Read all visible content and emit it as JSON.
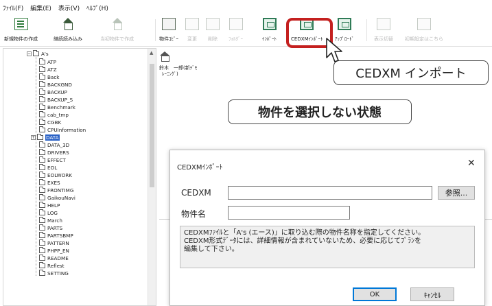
{
  "menu": [
    "ﾌｧｲﾙ(F)",
    "編集(E)",
    "表示(V)",
    "ﾍﾙﾌﾟ(H)"
  ],
  "toolbar": {
    "items": [
      {
        "label": "新規物件の作成",
        "icon": "new-doc-icon",
        "enabled": true
      },
      {
        "label": "継続読み込み",
        "icon": "house-open-icon",
        "enabled": true
      },
      {
        "label": "当初物件で作成",
        "icon": "house-copy-icon",
        "enabled": false
      },
      {
        "label": "物件ｺﾋﾟｰ",
        "icon": "copy-icon",
        "enabled": true
      },
      {
        "label": "変更",
        "icon": "edit-icon",
        "enabled": false
      },
      {
        "label": "削除",
        "icon": "delete-icon",
        "enabled": false
      },
      {
        "label": "ﾌｫﾙﾀﾞｰ",
        "icon": "folder-icon",
        "enabled": false
      },
      {
        "label": "ｲﾝﾎﾟｰﾄ",
        "icon": "import-icon",
        "enabled": true
      },
      {
        "label": "CEDXMｲﾝﾎﾟｰﾄ",
        "icon": "cedxm-import-icon",
        "enabled": true
      },
      {
        "label": "ｱｯﾌﾟﾛｰﾄﾞ",
        "icon": "upload-icon",
        "enabled": true
      },
      {
        "label": "表示切替",
        "icon": "view-icon",
        "enabled": false
      },
      {
        "label": "初期設定はこちら",
        "icon": "settings-icon",
        "enabled": false
      }
    ],
    "highlight_color": "#c4201f"
  },
  "tree": {
    "root": "A's",
    "selected": "DATA",
    "items": [
      "ATP",
      "ATZ",
      "Back",
      "BACKGND",
      "BACKUP",
      "BACKUP_S",
      "Benchmark",
      "cab_tmp",
      "CGBK",
      "CPUInformation",
      "DATA",
      "DATA_3D",
      "DRIVERS",
      "EFFECT",
      "EOL",
      "EOLWORK",
      "EXES",
      "FRONTIMG",
      "GaikouNavi",
      "HELP",
      "LOG",
      "March",
      "PARTS",
      "PARTSBMP",
      "PATTERN",
      "PHPP_EN",
      "README",
      "Reflest",
      "SETTING"
    ]
  },
  "right_panel": {
    "file_line1": "鈴木　一郎(新ﾃﾞﾓ",
    "file_line2": "ﾚｰﾆﾝｸﾞ)"
  },
  "callouts": {
    "import": "CEDXM インポート",
    "state": "物件を選択しない状態"
  },
  "dialog": {
    "title": "CEDXMｲﾝﾎﾟｰﾄ",
    "cedxm_label": "CEDXM",
    "cedxm_value": "",
    "name_label": "物件名",
    "name_value": "",
    "browse": "参照...",
    "description": "CEDXMﾌｧｲﾙと「A's (エース)」に取り込む際の物件名称を指定してください。\nCEDXM形式ﾃﾞｰﾀには、詳細情報が含まれていないため、必要に応じてﾌﾟﾗﾝを\n編集して下さい。",
    "ok": "OK",
    "cancel": "ｷｬﾝｾﾙ"
  }
}
